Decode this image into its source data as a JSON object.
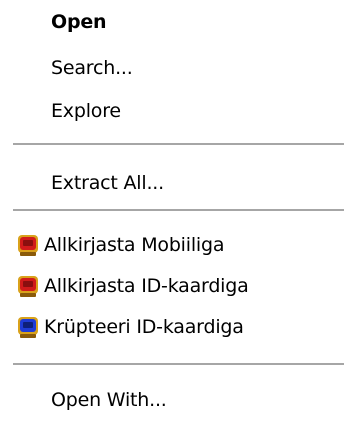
{
  "menu": {
    "items": [
      {
        "label": "Open"
      },
      {
        "label": "Search..."
      },
      {
        "label": "Explore"
      },
      {
        "label": "Extract All..."
      },
      {
        "label": "Allkirjasta Mobiiliga",
        "icon": "red-card-reader-icon"
      },
      {
        "label": "Allkirjasta ID-kaardiga",
        "icon": "red-card-reader-icon"
      },
      {
        "label": "Krüpteeri ID-kaardiga",
        "icon": "blue-card-reader-icon"
      },
      {
        "label": "Open With..."
      }
    ]
  },
  "colors": {
    "separator": "#a6a6a6",
    "red_icon": "#d11b1b",
    "blue_icon": "#1f3bd6",
    "icon_frame": "#d9a21b"
  }
}
